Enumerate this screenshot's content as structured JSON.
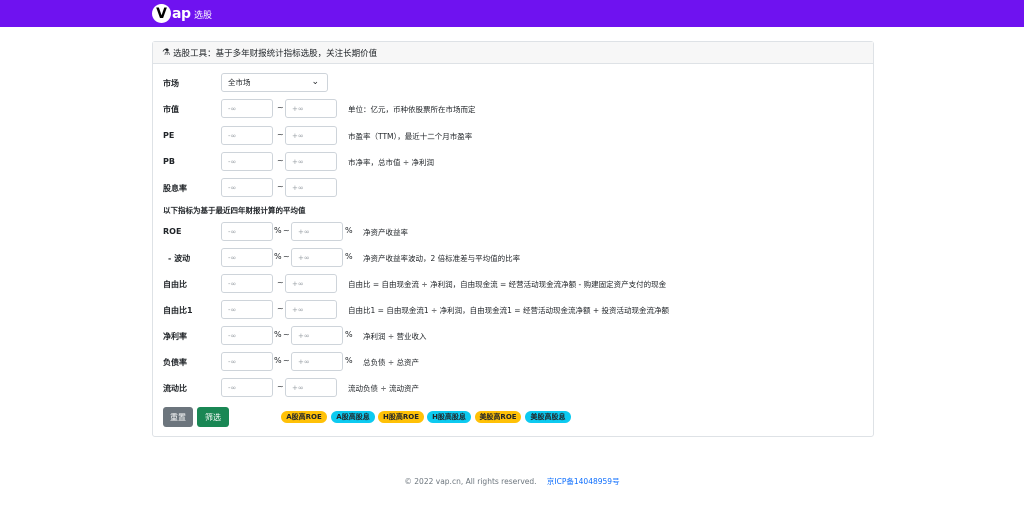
{
  "nav": {
    "logo_v": "V",
    "logo_rest": "ap",
    "link": "选股"
  },
  "card": {
    "header_icon": "flask-icon",
    "header_text": "选股工具：基于多年财报统计指标选股，关注长期价值"
  },
  "market": {
    "label": "市场",
    "value": "全市场"
  },
  "neg_inf": "-∞",
  "pos_inf": "+∞",
  "tilde": "~",
  "pct": "%",
  "rows_top": [
    {
      "label": "市值",
      "desc": "单位：亿元，币种依股票所在市场而定"
    },
    {
      "label": "PE",
      "desc": "市盈率（TTM），最近十二个月市盈率"
    },
    {
      "label": "PB",
      "desc": "市净率，总市值 ÷ 净利润"
    },
    {
      "label": "股息率",
      "desc": ""
    }
  ],
  "section_title": "以下指标为基于最近四年财报计算的平均值",
  "rows_bottom": [
    {
      "label": "ROE",
      "desc": "净资产收益率"
    },
    {
      "label": "- 波动",
      "desc": "净资产收益率波动，2 倍标准差与平均值的比率"
    },
    {
      "label": "自由比",
      "desc": "自由比 = 自由现金流 ÷ 净利润，自由现金流 = 经营活动现金流净额 - 购建固定资产支付的现金"
    },
    {
      "label": "自由比1",
      "desc": "自由比1 = 自由现金流1 ÷ 净利润，自由现金流1 = 经营活动现金流净额 + 投资活动现金流净额"
    },
    {
      "label": "净利率",
      "desc": "净利润 ÷ 营业收入"
    },
    {
      "label": "负债率",
      "desc": "总负债 ÷ 总资产"
    },
    {
      "label": "流动比",
      "desc": "流动负债 ÷ 流动资产"
    }
  ],
  "buttons": {
    "reset": "重置",
    "filter": "筛选"
  },
  "presets": [
    "A股高ROE",
    "A股高股息",
    "H股高ROE",
    "H股高股息",
    "美股高ROE",
    "美股高股息"
  ],
  "colors": {
    "nav": "#6f12f0",
    "badge_yellow": "#ffc107",
    "badge_cyan": "#0dcaf0",
    "btn_gray": "#6c757d",
    "btn_green": "#198754"
  },
  "footer": {
    "copyright": "© 2022 vap.cn, All rights reserved.",
    "icp": "京ICP备14048959号"
  }
}
